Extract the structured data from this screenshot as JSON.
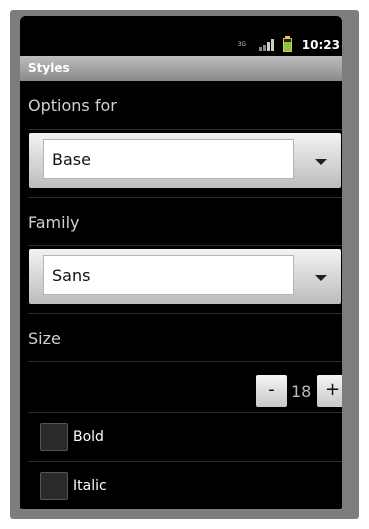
{
  "status_bar": {
    "network": "3G",
    "time": "10:23"
  },
  "title": "Styles",
  "options_for": {
    "label": "Options for",
    "selected": "Base"
  },
  "family": {
    "label": "Family",
    "selected": "Sans"
  },
  "size": {
    "label": "Size",
    "minus": "-",
    "value": "18",
    "plus": "+"
  },
  "checks": [
    {
      "label": "Bold",
      "checked": false
    },
    {
      "label": "Italic",
      "checked": false
    }
  ],
  "colors": {
    "accent_bar": "#a3a3a3",
    "battery": "#86c740",
    "background": "#000000"
  }
}
